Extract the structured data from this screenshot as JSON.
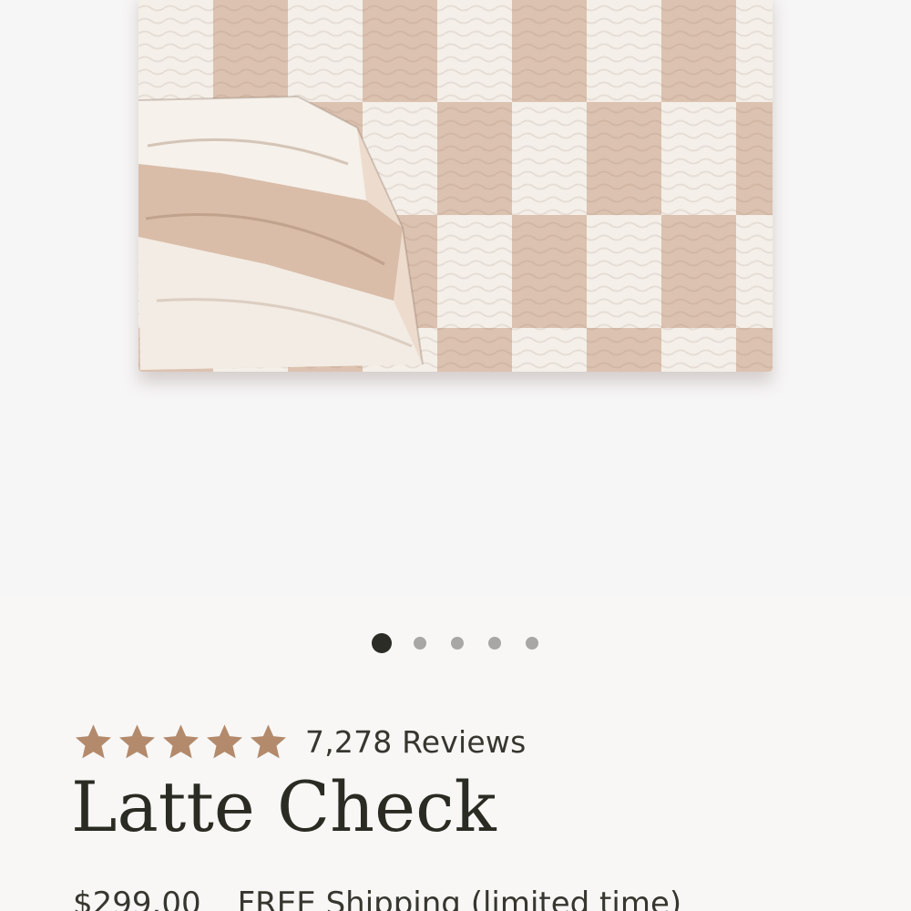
{
  "product": {
    "rating": 5,
    "rating_max": 5,
    "reviews_label": "7,278 Reviews",
    "title": "Latte Check",
    "price": "$299.00",
    "shipping_note": "FREE Shipping (limited time)"
  },
  "gallery": {
    "image_count": 5,
    "active_index": 0,
    "image_subject": "blanket"
  },
  "colors": {
    "star": "#b38a6b",
    "text": "#2a2b22",
    "dot_active": "#2a2c25",
    "dot_inactive": "#a8a7a5",
    "check_tan": "#dcc2b0",
    "check_cream": "#f4efe8"
  }
}
